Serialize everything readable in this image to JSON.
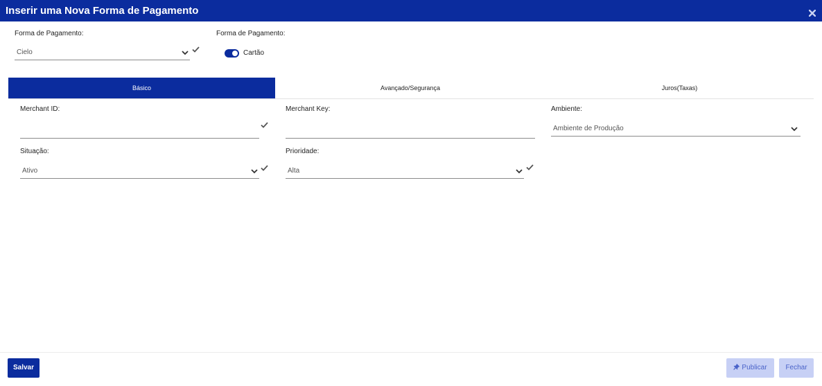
{
  "window": {
    "title": "Inserir uma Nova Forma de Pagamento"
  },
  "top": {
    "payment_label": "Forma de Pagamento:",
    "payment_value": "Cielo",
    "payment_type_label": "Forma de Pagamento:",
    "payment_type_toggle": "Cartão"
  },
  "tabs": [
    "Básico",
    "Avançado/Segurança",
    "Juros(Taxas)"
  ],
  "form": {
    "merchant_id_label": "Merchant ID:",
    "merchant_id_value": "",
    "merchant_key_label": "Merchant Key:",
    "merchant_key_value": "",
    "ambiente_label": "Ambiente:",
    "ambiente_value": "Ambiente de Produção",
    "situacao_label": "Situação:",
    "situacao_value": "Ativo",
    "prioridade_label": "Prioridade:",
    "prioridade_value": "Alta"
  },
  "footer": {
    "save": "Salvar",
    "publish": "Publicar",
    "close": "Fechar"
  },
  "colors": {
    "primary": "#0b2c9e",
    "secondary_btn": "#c7d0f5",
    "secondary_text": "#4a63c9"
  },
  "icons": [
    "close-icon",
    "chevron-down-icon",
    "check-icon",
    "pin-icon"
  ]
}
